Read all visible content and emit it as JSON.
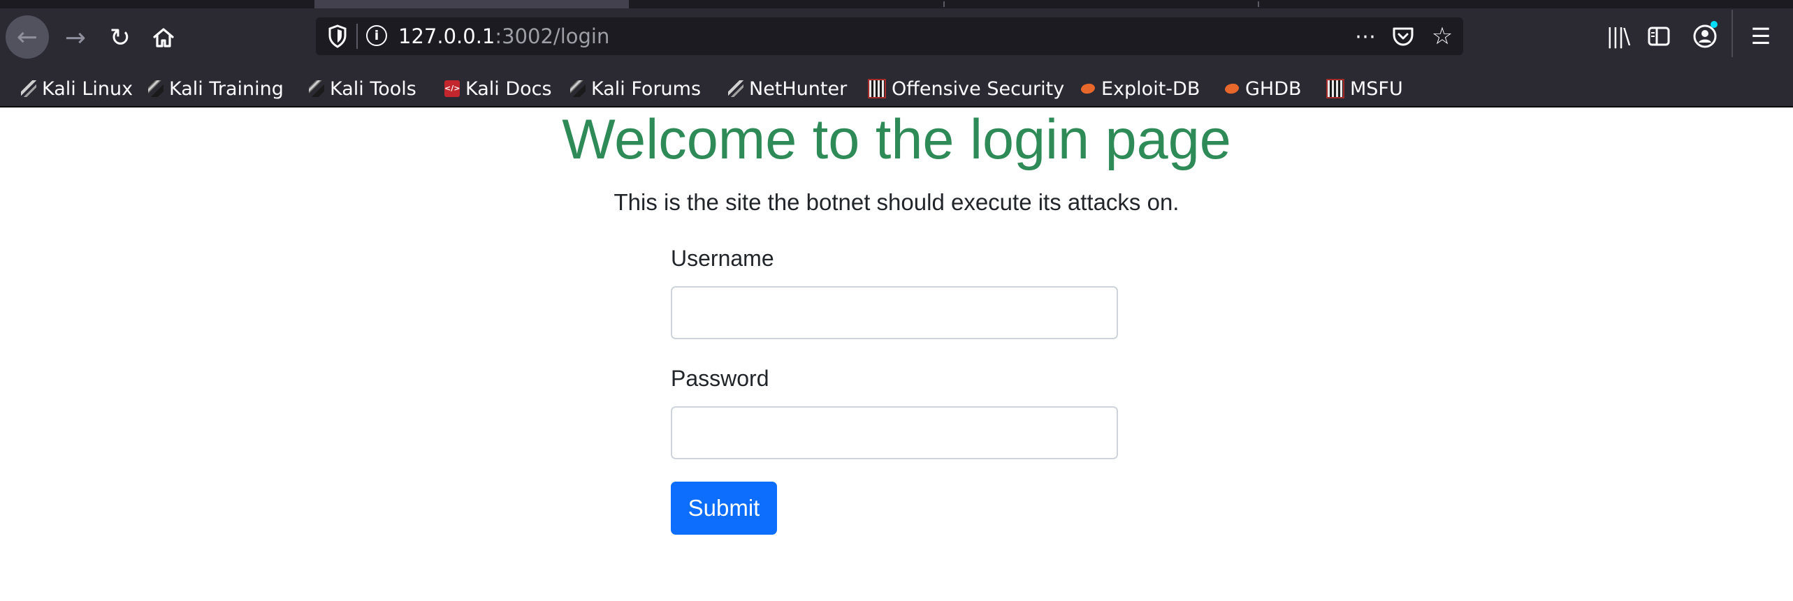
{
  "browser": {
    "url_host": "127.0.0.1",
    "url_port_path": ":3002/login",
    "icons": {
      "back": "back-arrow-icon",
      "forward": "forward-arrow-icon",
      "reload": "reload-icon",
      "home": "home-icon",
      "tracking_protection": "shield-icon",
      "site_info": "info-icon",
      "page_actions": "more-horizontal-icon",
      "pocket": "pocket-icon",
      "bookmark": "star-icon",
      "library": "library-icon",
      "sidebar": "sidebar-icon",
      "account": "account-icon",
      "menu": "hamburger-menu-icon"
    },
    "info_glyph": "i",
    "colors": {
      "chrome": "#2b2a33",
      "urlbar": "#1c1b22",
      "chrome_text": "#fbfbfe"
    }
  },
  "bookmarks": [
    {
      "label": "Kali Linux",
      "icon": "kali-dragon-icon"
    },
    {
      "label": "Kali Training",
      "icon": "kali-blade-icon"
    },
    {
      "label": "Kali Tools",
      "icon": "kali-blade-icon"
    },
    {
      "label": "Kali Docs",
      "icon": "kali-docs-icon"
    },
    {
      "label": "Kali Forums",
      "icon": "kali-blade-icon"
    },
    {
      "label": "NetHunter",
      "icon": "nethunter-dragon-icon"
    },
    {
      "label": "Offensive Security",
      "icon": "offsec-icon"
    },
    {
      "label": "Exploit-DB",
      "icon": "exploit-db-icon"
    },
    {
      "label": "GHDB",
      "icon": "exploit-db-icon"
    },
    {
      "label": "MSFU",
      "icon": "offsec-icon"
    }
  ],
  "page": {
    "title": "Welcome to the login page",
    "subtitle": "This is the site the botnet should execute its attacks on.",
    "username_label": "Username",
    "username_value": "",
    "password_label": "Password",
    "password_value": "",
    "submit_label": "Submit",
    "colors": {
      "title": "#2e8b57",
      "button": "#0d6efd"
    }
  }
}
